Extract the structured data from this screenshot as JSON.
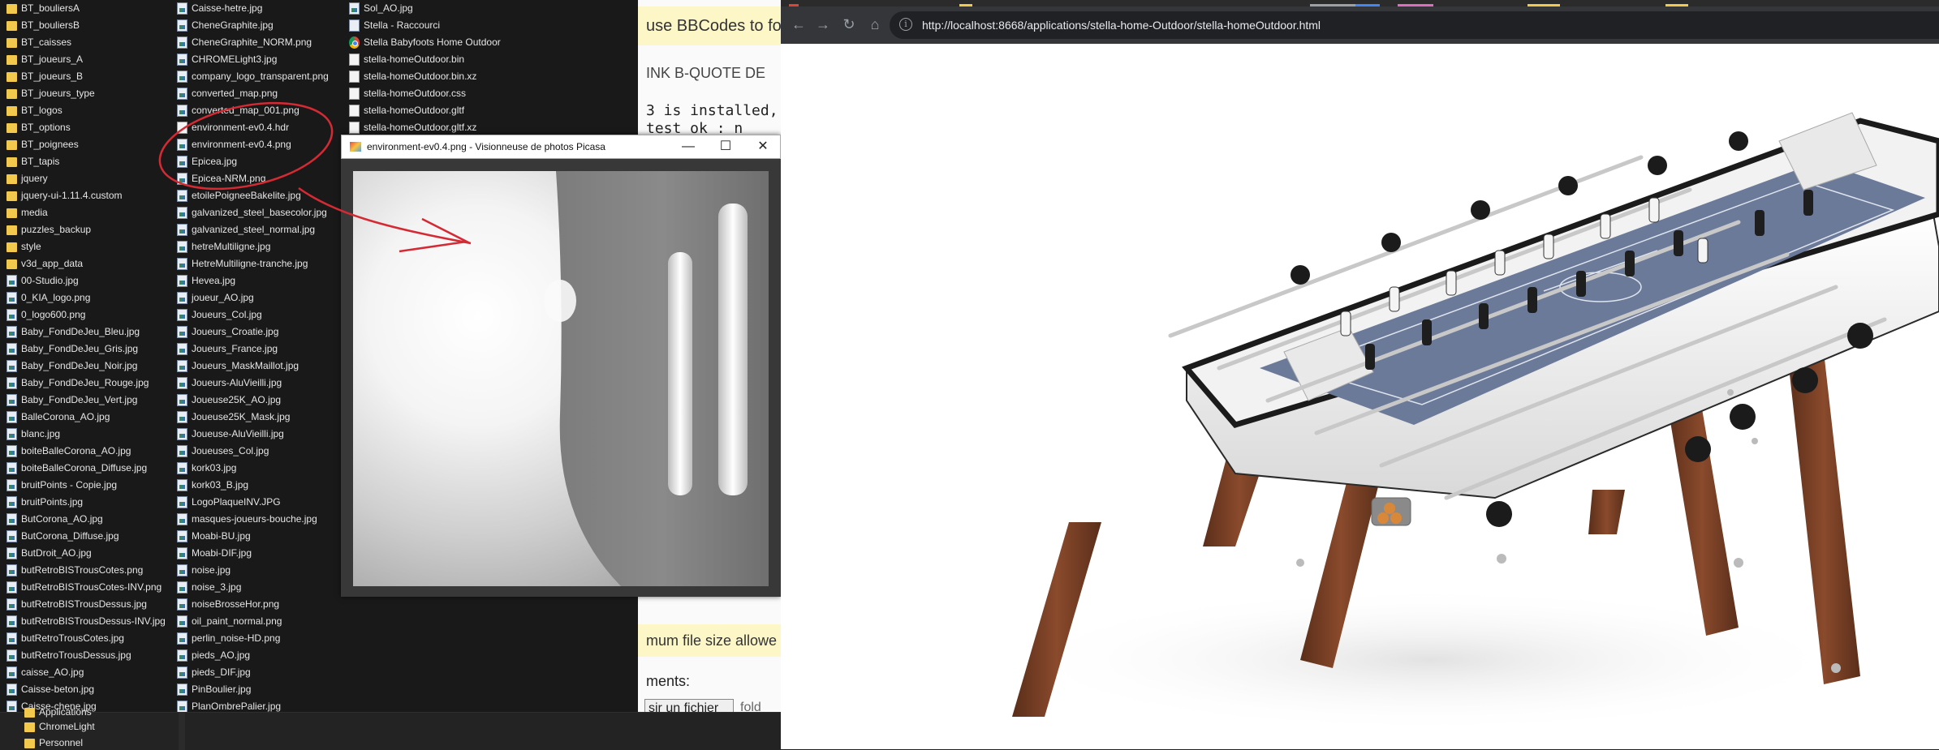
{
  "explorer": {
    "columns": [
      [
        {
          "name": "BT_bouliersA",
          "type": "folder"
        },
        {
          "name": "BT_bouliersB",
          "type": "folder"
        },
        {
          "name": "BT_caisses",
          "type": "folder"
        },
        {
          "name": "BT_joueurs_A",
          "type": "folder"
        },
        {
          "name": "BT_joueurs_B",
          "type": "folder"
        },
        {
          "name": "BT_joueurs_type",
          "type": "folder"
        },
        {
          "name": "BT_logos",
          "type": "folder"
        },
        {
          "name": "BT_options",
          "type": "folder"
        },
        {
          "name": "BT_poignees",
          "type": "folder"
        },
        {
          "name": "BT_tapis",
          "type": "folder"
        },
        {
          "name": "jquery",
          "type": "folder"
        },
        {
          "name": "jquery-ui-1.11.4.custom",
          "type": "folder"
        },
        {
          "name": "media",
          "type": "folder"
        },
        {
          "name": "puzzles_backup",
          "type": "folder"
        },
        {
          "name": "style",
          "type": "folder"
        },
        {
          "name": "v3d_app_data",
          "type": "folder"
        },
        {
          "name": "00-Studio.jpg",
          "type": "image"
        },
        {
          "name": "0_KIA_logo.png",
          "type": "image"
        },
        {
          "name": "0_logo600.png",
          "type": "image"
        },
        {
          "name": "Baby_FondDeJeu_Bleu.jpg",
          "type": "image"
        },
        {
          "name": "Baby_FondDeJeu_Gris.jpg",
          "type": "image"
        },
        {
          "name": "Baby_FondDeJeu_Noir.jpg",
          "type": "image"
        },
        {
          "name": "Baby_FondDeJeu_Rouge.jpg",
          "type": "image"
        },
        {
          "name": "Baby_FondDeJeu_Vert.jpg",
          "type": "image"
        },
        {
          "name": "BalleCorona_AO.jpg",
          "type": "image"
        },
        {
          "name": "blanc.jpg",
          "type": "image"
        },
        {
          "name": "boiteBalleCorona_AO.jpg",
          "type": "image"
        },
        {
          "name": "boiteBalleCorona_Diffuse.jpg",
          "type": "image"
        },
        {
          "name": "bruitPoints - Copie.jpg",
          "type": "image"
        },
        {
          "name": "bruitPoints.jpg",
          "type": "image"
        },
        {
          "name": "ButCorona_AO.jpg",
          "type": "image"
        },
        {
          "name": "ButCorona_Diffuse.jpg",
          "type": "image"
        },
        {
          "name": "ButDroit_AO.jpg",
          "type": "image"
        },
        {
          "name": "butRetroBISTrousCotes.png",
          "type": "image"
        },
        {
          "name": "butRetroBISTrousCotes-INV.png",
          "type": "image"
        },
        {
          "name": "butRetroBISTrousDessus.jpg",
          "type": "image"
        },
        {
          "name": "butRetroBISTrousDessus-INV.jpg",
          "type": "image"
        },
        {
          "name": "butRetroTrousCotes.jpg",
          "type": "image"
        },
        {
          "name": "butRetroTrousDessus.jpg",
          "type": "image"
        },
        {
          "name": "caisse_AO.jpg",
          "type": "image"
        },
        {
          "name": "Caisse-beton.jpg",
          "type": "image"
        },
        {
          "name": "Caisse-chene.jpg",
          "type": "image"
        }
      ],
      [
        {
          "name": "Caisse-hetre.jpg",
          "type": "image"
        },
        {
          "name": "CheneGraphite.jpg",
          "type": "image"
        },
        {
          "name": "CheneGraphite_NORM.png",
          "type": "image"
        },
        {
          "name": "CHROMELight3.jpg",
          "type": "image"
        },
        {
          "name": "company_logo_transparent.png",
          "type": "image"
        },
        {
          "name": "converted_map.png",
          "type": "image"
        },
        {
          "name": "converted_map_001.png",
          "type": "image"
        },
        {
          "name": "environment-ev0.4.hdr",
          "type": "doc"
        },
        {
          "name": "environment-ev0.4.png",
          "type": "image"
        },
        {
          "name": "Epicea.jpg",
          "type": "image"
        },
        {
          "name": "Epicea-NRM.png",
          "type": "image"
        },
        {
          "name": "etoilePoigneeBakelite.jpg",
          "type": "image"
        },
        {
          "name": "galvanized_steel_basecolor.jpg",
          "type": "image"
        },
        {
          "name": "galvanized_steel_normal.jpg",
          "type": "image"
        },
        {
          "name": "hetreMultiligne.jpg",
          "type": "image"
        },
        {
          "name": "HetreMultiligne-tranche.jpg",
          "type": "image"
        },
        {
          "name": "Hevea.jpg",
          "type": "image"
        },
        {
          "name": "joueur_AO.jpg",
          "type": "image"
        },
        {
          "name": "Joueurs_Col.jpg",
          "type": "image"
        },
        {
          "name": "Joueurs_Croatie.jpg",
          "type": "image"
        },
        {
          "name": "Joueurs_France.jpg",
          "type": "image"
        },
        {
          "name": "Joueurs_MaskMaillot.jpg",
          "type": "image"
        },
        {
          "name": "Joueurs-AluVieilli.jpg",
          "type": "image"
        },
        {
          "name": "Joueuse25K_AO.jpg",
          "type": "image"
        },
        {
          "name": "Joueuse25K_Mask.jpg",
          "type": "image"
        },
        {
          "name": "Joueuse-AluVieilli.jpg",
          "type": "image"
        },
        {
          "name": "Joueuses_Col.jpg",
          "type": "image"
        },
        {
          "name": "kork03.jpg",
          "type": "image"
        },
        {
          "name": "kork03_B.jpg",
          "type": "image"
        },
        {
          "name": "LogoPlaqueINV.JPG",
          "type": "image"
        },
        {
          "name": "masques-joueurs-bouche.jpg",
          "type": "image"
        },
        {
          "name": "Moabi-BU.jpg",
          "type": "image"
        },
        {
          "name": "Moabi-DIF.jpg",
          "type": "image"
        },
        {
          "name": "noise.jpg",
          "type": "image"
        },
        {
          "name": "noise_3.jpg",
          "type": "image"
        },
        {
          "name": "noiseBrosseHor.png",
          "type": "image"
        },
        {
          "name": "oil_paint_normal.png",
          "type": "image"
        },
        {
          "name": "perlin_noise-HD.png",
          "type": "image"
        },
        {
          "name": "pieds_AO.jpg",
          "type": "image"
        },
        {
          "name": "pieds_DIF.jpg",
          "type": "image"
        },
        {
          "name": "PinBoulier.jpg",
          "type": "image"
        },
        {
          "name": "PlanOmbrePalier.jpg",
          "type": "image"
        }
      ],
      [
        {
          "name": "Sol_AO.jpg",
          "type": "image"
        },
        {
          "name": "Stella - Raccourci",
          "type": "shortcut"
        },
        {
          "name": "Stella Babyfoots Home Outdoor",
          "type": "chrome"
        },
        {
          "name": "stella-homeOutdoor.bin",
          "type": "doc"
        },
        {
          "name": "stella-homeOutdoor.bin.xz",
          "type": "doc"
        },
        {
          "name": "stella-homeOutdoor.css",
          "type": "doc"
        },
        {
          "name": "stella-homeOutdoor.gltf",
          "type": "doc"
        },
        {
          "name": "stella-homeOutdoor.gltf.xz",
          "type": "doc"
        }
      ]
    ]
  },
  "taskbar": {
    "items": [
      {
        "label": "Applications"
      },
      {
        "label": "ChromeLight"
      },
      {
        "label": "Personnel"
      }
    ]
  },
  "forum": {
    "notice": "use BBCodes to for",
    "bbcodes": "INK  B-QUOTE  DE",
    "code_line1": "3 is installed,",
    "code_line2": "  test ok : n",
    "size_notice": "mum file size allowe",
    "attachments_label": "ments:",
    "file_button": "sir un fichier",
    "file_status": "fold"
  },
  "viewer": {
    "title": "environment-ev0.4.png - Visionneuse de photos Picasa",
    "minimize": "—",
    "maximize": "☐",
    "close": "✕"
  },
  "browser": {
    "url": "http://localhost:8668/applications/stella-home-Outdoor/stella-homeOutdoor.html",
    "back": "←",
    "forward": "→",
    "reload": "↻",
    "home": "⌂",
    "info": "i"
  },
  "colors": {
    "annotation": "#d42a34",
    "chrome_toolbar": "#35363a",
    "omnibox": "#202124",
    "folder": "#f2c94c"
  }
}
